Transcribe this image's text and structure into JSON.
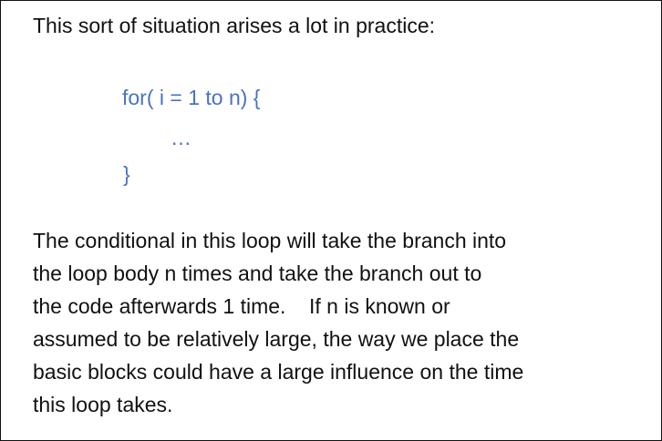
{
  "intro_text": "This sort of situation arises a lot in practice:",
  "code": {
    "line1": "for( i = 1 to n) {",
    "line2": "…",
    "line3": "}"
  },
  "paragraph": {
    "line1": "The conditional in this loop will take the branch into",
    "line2": "the loop body n times and take the branch out to",
    "line3": "the code afterwards 1 time.    If n is known or",
    "line4": "assumed to be relatively large, the way we place the",
    "line5": "basic blocks could have a large influence on the time",
    "line6": "this loop takes."
  }
}
